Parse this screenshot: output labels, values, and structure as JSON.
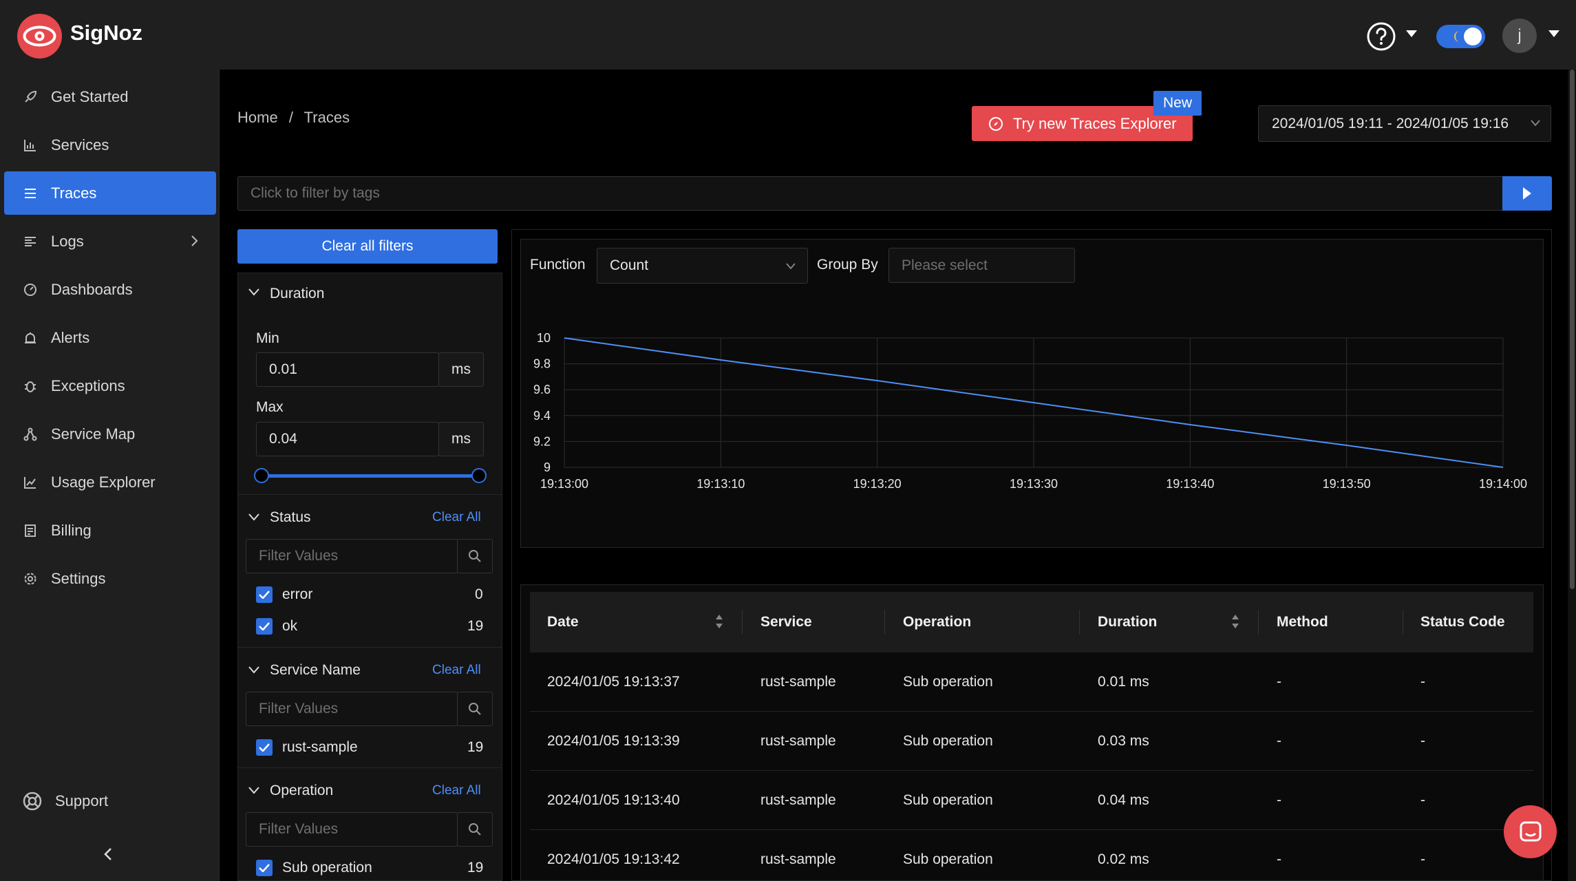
{
  "app": {
    "name": "SigNoz",
    "user_initial": "j"
  },
  "sidebar": {
    "items": [
      {
        "label": "Get Started",
        "icon": "rocket-icon"
      },
      {
        "label": "Services",
        "icon": "bar-chart-icon"
      },
      {
        "label": "Traces",
        "icon": "menu-icon",
        "active": true
      },
      {
        "label": "Logs",
        "icon": "lines-icon",
        "has_children": true
      },
      {
        "label": "Dashboards",
        "icon": "dashboard-icon"
      },
      {
        "label": "Alerts",
        "icon": "alarm-icon"
      },
      {
        "label": "Exceptions",
        "icon": "bug-icon"
      },
      {
        "label": "Service Map",
        "icon": "deployment-icon"
      },
      {
        "label": "Usage Explorer",
        "icon": "line-chart-icon"
      },
      {
        "label": "Billing",
        "icon": "billing-icon"
      },
      {
        "label": "Settings",
        "icon": "settings-icon"
      }
    ],
    "support_label": "Support"
  },
  "breadcrumb": {
    "home": "Home",
    "separator": "/",
    "current": "Traces"
  },
  "try_explorer": {
    "label": "Try new Traces Explorer",
    "badge": "New"
  },
  "time_range": "2024/01/05 19:11 - 2024/01/05 19:16",
  "tag_filter": {
    "placeholder": "Click to filter by tags"
  },
  "filters": {
    "clear_all_label": "Clear all filters",
    "duration": {
      "title": "Duration",
      "min_label": "Min",
      "min_value": "0.01",
      "min_unit": "ms",
      "max_label": "Max",
      "max_value": "0.04",
      "max_unit": "ms"
    },
    "status": {
      "title": "Status",
      "clear_label": "Clear All",
      "search_placeholder": "Filter Values",
      "options": [
        {
          "label": "error",
          "count": "0"
        },
        {
          "label": "ok",
          "count": "19"
        }
      ]
    },
    "service_name": {
      "title": "Service Name",
      "clear_label": "Clear All",
      "search_placeholder": "Filter Values",
      "options": [
        {
          "label": "rust-sample",
          "count": "19"
        }
      ]
    },
    "operation": {
      "title": "Operation",
      "clear_label": "Clear All",
      "search_placeholder": "Filter Values",
      "options": [
        {
          "label": "Sub operation",
          "count": "19"
        }
      ]
    }
  },
  "chart_controls": {
    "function_label": "Function",
    "function_value": "Count",
    "group_by_label": "Group By",
    "group_by_placeholder": "Please select"
  },
  "chart_data": {
    "type": "line",
    "x": [
      "19:13:00",
      "19:13:10",
      "19:13:20",
      "19:13:30",
      "19:13:40",
      "19:13:50",
      "19:14:00"
    ],
    "series": [
      {
        "values": [
          10,
          9.83,
          9.67,
          9.5,
          9.33,
          9.17,
          9
        ]
      }
    ],
    "y_ticks": [
      "10",
      "9.8",
      "9.6",
      "9.4",
      "9.2",
      "9"
    ],
    "ylim": [
      9,
      10
    ],
    "grid": true,
    "line_color": "#4e8ff7"
  },
  "table": {
    "columns": [
      "Date",
      "Service",
      "Operation",
      "Duration",
      "Method",
      "Status Code"
    ],
    "rows": [
      [
        "2024/01/05 19:13:37",
        "rust-sample",
        "Sub operation",
        "0.01 ms",
        "-",
        "-"
      ],
      [
        "2024/01/05 19:13:39",
        "rust-sample",
        "Sub operation",
        "0.03 ms",
        "-",
        "-"
      ],
      [
        "2024/01/05 19:13:40",
        "rust-sample",
        "Sub operation",
        "0.04 ms",
        "-",
        "-"
      ],
      [
        "2024/01/05 19:13:42",
        "rust-sample",
        "Sub operation",
        "0.02 ms",
        "-",
        "-"
      ]
    ]
  },
  "colors": {
    "accent": "#2f6fe0",
    "brand_red": "#e5484d",
    "background": "#000000",
    "panel": "#1f1f1f"
  }
}
